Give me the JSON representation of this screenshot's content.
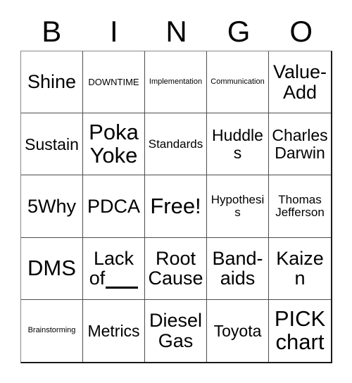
{
  "card": {
    "title": "Bingo Card",
    "header_letters": [
      "B",
      "I",
      "N",
      "G",
      "O"
    ],
    "free_space_label": "Free!",
    "colors": {
      "text": "#000000",
      "grid_line": "#4d4d4d",
      "outer_border": "#1a1a1a",
      "background": "#ffffff"
    },
    "rows": [
      [
        {
          "text": "Shine",
          "size": "lg"
        },
        {
          "text": "DOWNTIME",
          "size": "xs"
        },
        {
          "text": "Implementation",
          "size": "xxs"
        },
        {
          "text": "Communication",
          "size": "xxs"
        },
        {
          "text": "Value-Add",
          "size": "lg"
        }
      ],
      [
        {
          "text": "Sustain",
          "size": "md"
        },
        {
          "text": "Poka Yoke",
          "size": "xl"
        },
        {
          "text": "Standards",
          "size": "sm"
        },
        {
          "text": "Huddles",
          "size": "md"
        },
        {
          "text": "Charles Darwin",
          "size": "md"
        }
      ],
      [
        {
          "text": "5Why",
          "size": "lg"
        },
        {
          "text": "PDCA",
          "size": "lg"
        },
        {
          "text": "Free!",
          "size": "xl"
        },
        {
          "text": "Hypothesis",
          "size": "sm"
        },
        {
          "text": "Thomas Jefferson",
          "size": "sm"
        }
      ],
      [
        {
          "text": "DMS",
          "size": "xl"
        },
        {
          "text": "Lack of",
          "size": "lg",
          "blank": true
        },
        {
          "text": "Root Cause",
          "size": "lg"
        },
        {
          "text": "Band-aids",
          "size": "lg"
        },
        {
          "text": "Kaizen",
          "size": "lg"
        }
      ],
      [
        {
          "text": "Brainstorming",
          "size": "xxs"
        },
        {
          "text": "Metrics",
          "size": "md"
        },
        {
          "text": "Diesel Gas",
          "size": "lg"
        },
        {
          "text": "Toyota",
          "size": "md"
        },
        {
          "text": "PICK chart",
          "size": "xl"
        }
      ]
    ]
  }
}
